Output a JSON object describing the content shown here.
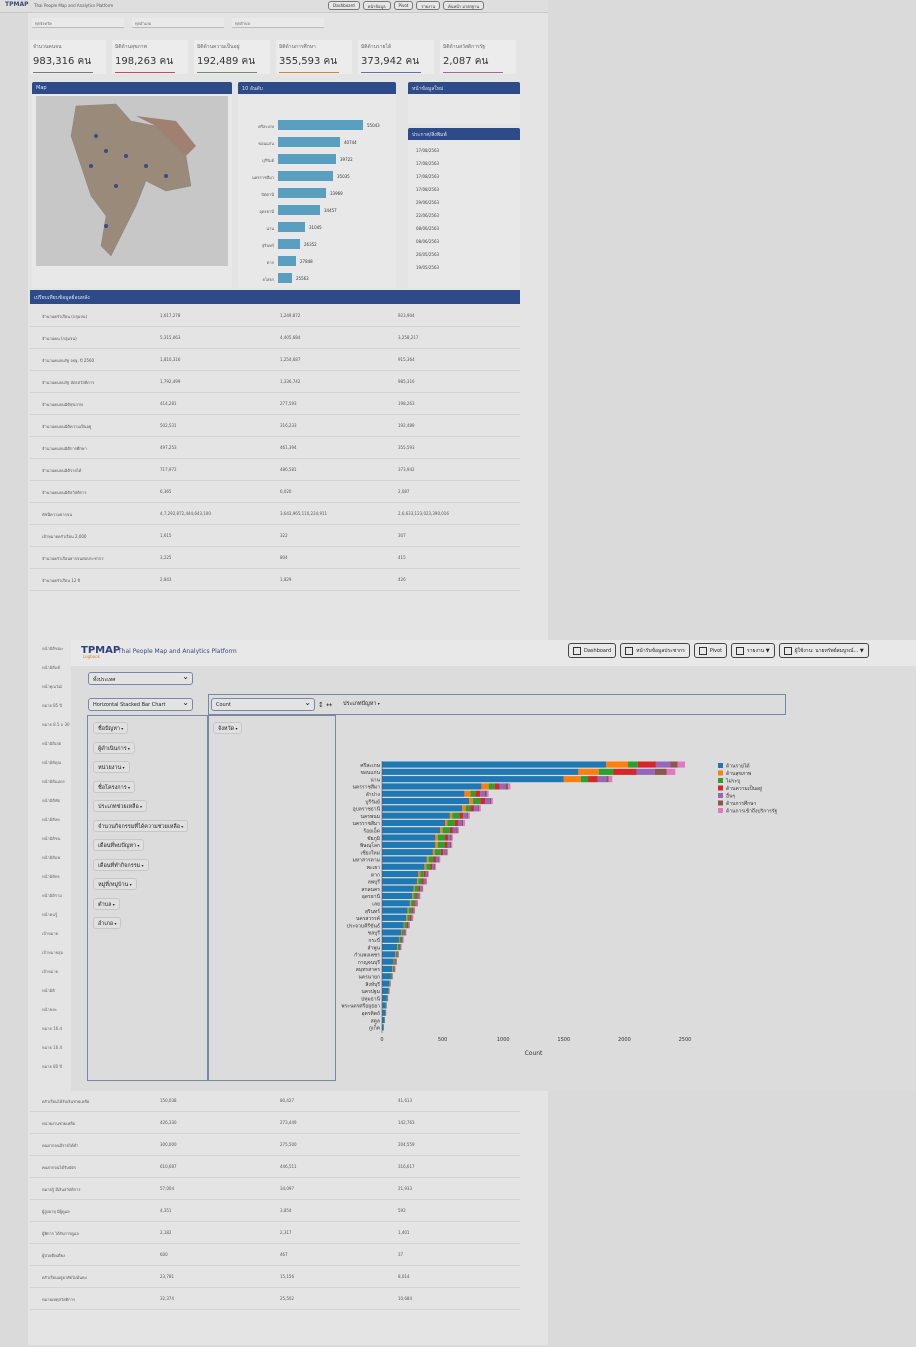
{
  "bg": {
    "app_title": "Thai People Map and Analytics Platform",
    "logo": "TPMAP",
    "nav": [
      "Dashboard",
      "หน้าข้อมูล",
      "Pivot",
      "รายงาน",
      "ค้นหน้า มาตรฐาน"
    ],
    "selects": [
      "ทุกจังหวัด",
      "ทุกอำเภอ",
      "ทุกตำบล"
    ],
    "cards": [
      {
        "label": "จำนวนคนจน",
        "value": "983,316 คน",
        "color": "#7a7a7a"
      },
      {
        "label": "มิติด้านสุขภาพ",
        "value": "198,263 คน",
        "color": "#c05050"
      },
      {
        "label": "มิติด้านความเป็นอยู่",
        "value": "192,489 คน",
        "color": "#6a8f6a"
      },
      {
        "label": "มิติด้านการศึกษา",
        "value": "355,593 คน",
        "color": "#c08a40"
      },
      {
        "label": "มิติด้านรายได้",
        "value": "373,942 คน",
        "color": "#6070a0"
      },
      {
        "label": "มิติด้านสวัสดิการรัฐ",
        "value": "2,087 คน",
        "color": "#9a6aa0"
      }
    ],
    "map_title": "Map",
    "top10_title": "10 อันดับ",
    "top10": [
      {
        "label": "ศรีสะเกษ",
        "value": "55043",
        "w": 85
      },
      {
        "label": "ขอนแก่น",
        "value": "40744",
        "w": 62
      },
      {
        "label": "บุรีรัมย์",
        "value": "39722",
        "w": 58
      },
      {
        "label": "นครราชสีมา",
        "value": "35035",
        "w": 55
      },
      {
        "label": "ปัตตานี",
        "value": "33969",
        "w": 48
      },
      {
        "label": "อุดรธานี",
        "value": "34457",
        "w": 42
      },
      {
        "label": "น่าน",
        "value": "31045",
        "w": 27
      },
      {
        "label": "สุรินทร์",
        "value": "26352",
        "w": 22
      },
      {
        "label": "ตาก",
        "value": "27848",
        "w": 18
      },
      {
        "label": "ยโสธร",
        "value": "25563",
        "w": 14
      }
    ],
    "news_title": "หน้าข้อมูลใหม่",
    "news2_title": "ประกาศ/สิ่งพิมพ์",
    "news_items": [
      "17/08/2563",
      "17/08/2563",
      "17/08/2563",
      "17/08/2563",
      "29/06/2563",
      "22/06/2563",
      "08/06/2563",
      "08/06/2563",
      "26/05/2563",
      "19/05/2563"
    ],
    "table_title": "เปรียบเทียบข้อมูลย้อนหลัง",
    "table_rows": [
      [
        "จำนวนครัวเรือน (กลุ่มจน)",
        "1,617,278",
        "1,249,872",
        "923,904"
      ],
      [
        "จำนวนคน (กลุ่มจน)",
        "5,315,063",
        "4,405,684",
        "3,258,217"
      ],
      [
        "จำนวนคนจนรัฐ จปฐ. ปี 2560",
        "1,810,316",
        "1,254,687",
        "915,364"
      ],
      [
        "จำนวนคนจนรัฐ บัตรสวัสดิการ",
        "1,792,499",
        "1,336,742",
        "985,316"
      ],
      [
        "จำนวนคนจนมิติสุขภาพ",
        "414,281",
        "277,593",
        "198,263"
      ],
      [
        "จำนวนคนจนมิติความเป็นอยู่",
        "502,531",
        "316,233",
        "192,489"
      ],
      [
        "จำนวนคนจนมิติการศึกษา",
        "497,253",
        "461,394",
        "355,593"
      ],
      [
        "จำนวนคนจนมิติรายได้",
        "717,972",
        "486,581",
        "373,942"
      ],
      [
        "จำนวนคนจนมิติสวัสดิการ",
        "6,365",
        "6,020",
        "2,087"
      ],
      [
        "ดัชนีความยากจน",
        "4,7,292,872,444,643,100",
        "3,643,965,110,224,911",
        "2,6,633,123,023,390,016"
      ],
      [
        "เป้าหมายครัวเรือน 2,000",
        "1,615",
        "322",
        "307"
      ],
      [
        "จำนวนครัวเรือนยากจนต่อประชากร",
        "3,225",
        "804",
        "415"
      ],
      [
        "จำนวนครัวเรือน 12 ปี",
        "2,843",
        "1,829",
        "426"
      ]
    ],
    "left_labels": [
      "หน้ามิติขณะ",
      "หน้ามิติแท้",
      "หน้าคุณวัฒิ",
      "หมาย 85 ปี",
      "หมาย 8.5 อ 30 ปี",
      "หน้ามิติเสต",
      "หน้ามิติคุณ",
      "หน้ามิติแม่ตร",
      "หน้ามิติพัต",
      "หน้ามิติลด",
      "หน้ามิติชน",
      "หน้ามิติแพ",
      "หน้ามิติทร",
      "หน้ามิติราม",
      "หน้าคนรู้",
      "เป้าหมาย",
      "เป้าหมายลุ่ม",
      "เป้าหมาย",
      "หน้ามิติ",
      "หน้าขยะ",
      "หมาย 16.4",
      "หมาย 16.4",
      "หมาย 80 ปี"
    ],
    "bottom_rows": [
      [
        "ครัวเรือนได้รับเงินช่วยเหลือ",
        "150,038",
        "80,427",
        "41,613"
      ],
      [
        "หน่วยงานช่วยเหลือ",
        "426,330",
        "273,449",
        "142,763"
      ],
      [
        "คนยากจนมีรายได้ต่ำ",
        "300,000",
        "275,500",
        "204,559"
      ],
      [
        "คนยากจนได้รับบัตร",
        "610,687",
        "446,511",
        "316,617"
      ],
      [
        "หมายรู้ มีเงินสวัสดิการ",
        "57,004",
        "34,097",
        "21,933"
      ],
      [
        "ผู้สูงอายุ มีผู้ดูแล",
        "4,351",
        "3,854",
        "592"
      ],
      [
        "ผู้พิการ ได้รับการดูแล",
        "2,182",
        "2,317",
        "1,401"
      ],
      [
        "ผู้ป่วยติดเตียง",
        "600",
        "467",
        "37"
      ],
      [
        "ครัวเรือนอยู่อาศัยไม่มั่นคง",
        "23,781",
        "15,156",
        "8,014"
      ],
      [
        "หมายเหตุสวัสดิการ",
        "32,374",
        "25,502",
        "10,684"
      ]
    ]
  },
  "pivot": {
    "logo": "TPMAP",
    "logo_sub": "Logbook",
    "title": "Thai People Map and Analytics Platform",
    "nav": [
      {
        "label": "Dashboard",
        "name": "dashboard-button"
      },
      {
        "label": "หน้ารับข้อมูลประชากร",
        "name": "population-data-button"
      },
      {
        "label": "Pivot",
        "name": "pivot-button"
      },
      {
        "label": "รายงาน ▼",
        "name": "report-menu-button"
      },
      {
        "label": "ผู้ใช้งาน: นายทรัพย์สมบูรณ์... ▼",
        "name": "user-menu-button"
      }
    ],
    "source_select": "ทั้งประเทศ",
    "renderer_select": "Horizontal Stacked Bar Chart",
    "aggregator_select": "Count",
    "sort_arrows": "↕ ↔",
    "col_attr": "ประเภทปัญหา",
    "row_attr": "จังหวัด",
    "unused_attrs": [
      "ชื่อปัญหา",
      "ผู้ดำเนินการ",
      "หน่วยงาน",
      "ชื่อโครงการ",
      "ประเภทช่วยเหลือ",
      "จำนวนกิจกรรมที่ได้ความช่วยเหลือ",
      "เดือนที่พบปัญหา",
      "เดือนที่ทำกิจกรรม",
      "หมู่ที่/หมู่บ้าน",
      "ตำบล",
      "อำเภอ"
    ]
  },
  "chart_data": {
    "type": "bar",
    "orientation": "horizontal",
    "stacked": true,
    "xlabel": "Count",
    "xlim": [
      0,
      2500
    ],
    "xticks": [
      "0",
      "500",
      "1000",
      "1500",
      "2000",
      "2500"
    ],
    "legend_position": "right",
    "categories": [
      "ศรีสะเกษ",
      "ขอนแก่น",
      "น่าน",
      "นครราชสีมา",
      "ลำปาง",
      "บุรีรัมย์",
      "อุบลราชธานี",
      "นครพนม",
      "นครราชสีมา",
      "ร้อยเอ็ด",
      "ชัยภูมิ",
      "พิษณุโลก",
      "เชียงใหม่",
      "มหาสารคาม",
      "พะเยา",
      "ตาก",
      "ลพบุรี",
      "สกลนคร",
      "อุดรธานี",
      "เลย",
      "สุรินทร์",
      "นครสวรรค์",
      "ประจวบคีรีขันธ์",
      "ชลบุรี",
      "กระบี่",
      "ลำพูน",
      "กำแพงเพชร",
      "กาญจนบุรี",
      "สมุทรสาคร",
      "นครนายก",
      "สิงห์บุรี",
      "นครปฐม",
      "ปทุมธานี",
      "พระนครศรีอยุธยา",
      "อุตรดิตถ์",
      "สตูล",
      "ภูเก็ต"
    ],
    "series": [
      {
        "name": "ด้านรายได้",
        "color": "#1f77b4",
        "values": [
          1850,
          1620,
          1500,
          820,
          680,
          720,
          660,
          560,
          520,
          480,
          440,
          440,
          420,
          370,
          350,
          300,
          290,
          260,
          250,
          230,
          210,
          200,
          180,
          160,
          140,
          125,
          110,
          95,
          85,
          70,
          60,
          50,
          40,
          30,
          25,
          20,
          12
        ]
      },
      {
        "name": "ด้านสุขภาพ",
        "color": "#ff7f0e",
        "values": [
          180,
          170,
          140,
          60,
          50,
          30,
          30,
          20,
          20,
          20,
          20,
          20,
          15,
          15,
          15,
          15,
          10,
          10,
          10,
          10,
          10,
          10,
          5,
          5,
          5,
          5,
          5,
          5,
          5,
          0,
          0,
          0,
          0,
          0,
          0,
          0,
          0
        ]
      },
      {
        "name": "ไม่ระบุ",
        "color": "#2ca02c",
        "values": [
          80,
          120,
          60,
          50,
          40,
          60,
          40,
          60,
          60,
          60,
          60,
          60,
          50,
          40,
          35,
          30,
          30,
          30,
          25,
          25,
          25,
          20,
          20,
          15,
          15,
          15,
          10,
          10,
          10,
          10,
          5,
          5,
          5,
          5,
          5,
          3,
          2
        ]
      },
      {
        "name": "ด้านความเป็นอยู่",
        "color": "#d62728",
        "values": [
          150,
          190,
          80,
          40,
          40,
          40,
          30,
          30,
          30,
          25,
          25,
          20,
          20,
          20,
          15,
          15,
          15,
          15,
          10,
          10,
          10,
          10,
          10,
          8,
          8,
          6,
          6,
          5,
          5,
          4,
          3,
          3,
          2,
          2,
          2,
          1,
          1
        ]
      },
      {
        "name": "อื่นๆ",
        "color": "#9467bd",
        "values": [
          120,
          150,
          70,
          50,
          40,
          40,
          30,
          30,
          30,
          30,
          20,
          20,
          20,
          20,
          15,
          15,
          15,
          15,
          12,
          12,
          10,
          10,
          8,
          8,
          6,
          6,
          5,
          5,
          4,
          4,
          3,
          3,
          2,
          2,
          2,
          1,
          1
        ]
      },
      {
        "name": "ด้านการศึกษา",
        "color": "#8c564b",
        "values": [
          60,
          100,
          20,
          20,
          15,
          10,
          10,
          10,
          10,
          10,
          10,
          10,
          10,
          8,
          8,
          6,
          6,
          5,
          5,
          5,
          4,
          4,
          3,
          3,
          2,
          2,
          2,
          2,
          1,
          1,
          1,
          1,
          1,
          0,
          0,
          0,
          0
        ]
      },
      {
        "name": "ด้านการเข้าถึงบริการรัฐ",
        "color": "#e377c2",
        "values": [
          60,
          70,
          30,
          20,
          15,
          15,
          15,
          15,
          15,
          10,
          10,
          10,
          10,
          8,
          8,
          6,
          6,
          5,
          5,
          5,
          4,
          4,
          4,
          3,
          3,
          3,
          2,
          2,
          2,
          2,
          1,
          1,
          1,
          1,
          1,
          0,
          0
        ]
      }
    ]
  }
}
